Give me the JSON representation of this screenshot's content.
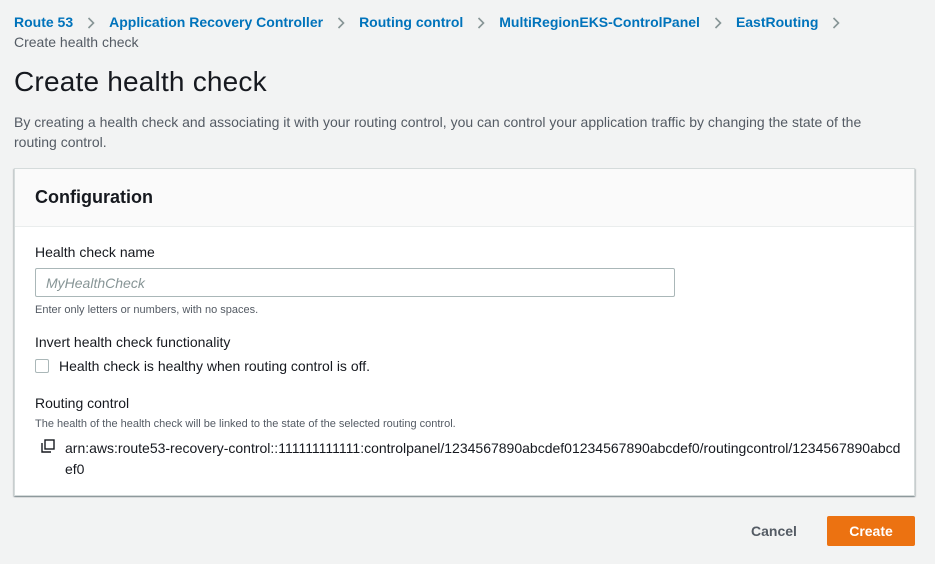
{
  "breadcrumb": {
    "items": [
      {
        "label": "Route 53"
      },
      {
        "label": "Application Recovery Controller"
      },
      {
        "label": "Routing control"
      },
      {
        "label": "MultiRegionEKS-ControlPanel"
      },
      {
        "label": "EastRouting"
      }
    ],
    "current": "Create health check"
  },
  "page": {
    "title": "Create health check",
    "description": "By creating a health check and associating it with your routing control, you can control your application traffic by changing the state of the routing control."
  },
  "configuration": {
    "title": "Configuration",
    "health_check_name": {
      "label": "Health check name",
      "value": "",
      "placeholder": "MyHealthCheck",
      "hint": "Enter only letters or numbers, with no spaces."
    },
    "invert": {
      "label": "Invert health check functionality",
      "checkbox_label": "Health check is healthy when routing control is off.",
      "checked": false
    },
    "routing_control": {
      "label": "Routing control",
      "hint": "The health of the health check will be linked to the state of the selected routing control.",
      "arn": "arn:aws:route53-recovery-control::111111111111:controlpanel/1234567890abcdef01234567890abcdef0/routingcontrol/1234567890abcdef0",
      "copy_icon": "copy-icon"
    }
  },
  "actions": {
    "cancel_label": "Cancel",
    "create_label": "Create"
  },
  "colors": {
    "link": "#0073bb",
    "primary_button": "#ec7211",
    "background": "#f2f3f3"
  }
}
